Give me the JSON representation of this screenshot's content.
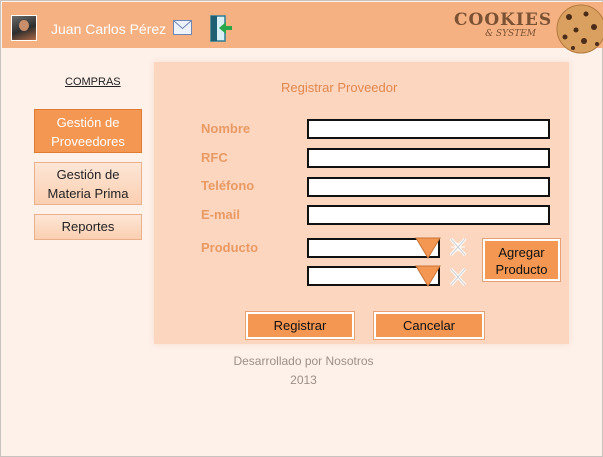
{
  "header": {
    "user_name": "Juan Carlos Pérez",
    "icons": {
      "avatar": "user-avatar",
      "mail": "mail-icon",
      "logout": "exit-door-icon"
    },
    "logo": {
      "main": "COOKIES",
      "sub": "& SYSTEM"
    }
  },
  "sidebar": {
    "section_title": "COMPRAS",
    "items": [
      {
        "line1": "Gestión de",
        "line2": "Proveedores",
        "active": true
      },
      {
        "line1": "Gestión de",
        "line2": "Materia Prima",
        "active": false
      },
      {
        "line1": "Reportes",
        "line2": "",
        "active": false
      }
    ]
  },
  "form": {
    "title": "Registrar Proveedor",
    "labels": {
      "nombre": "Nombre",
      "rfc": "RFC",
      "telefono": "Teléfono",
      "email": "E-mail",
      "producto": "Producto"
    },
    "values": {
      "nombre": "",
      "rfc": "",
      "telefono": "",
      "email": "",
      "producto_1": "",
      "producto_2": ""
    },
    "add_product_line1": "Agregar",
    "add_product_line2": "Producto",
    "submit": "Registrar",
    "cancel": "Cancelar"
  },
  "footer": {
    "line1": "Desarrollado por Nosotros",
    "line2": "2013"
  },
  "colors": {
    "background": "#fdf1ea",
    "header": "#f6b183",
    "panel": "#fcd6bf",
    "accent": "#f49752",
    "label": "#e99a64"
  }
}
